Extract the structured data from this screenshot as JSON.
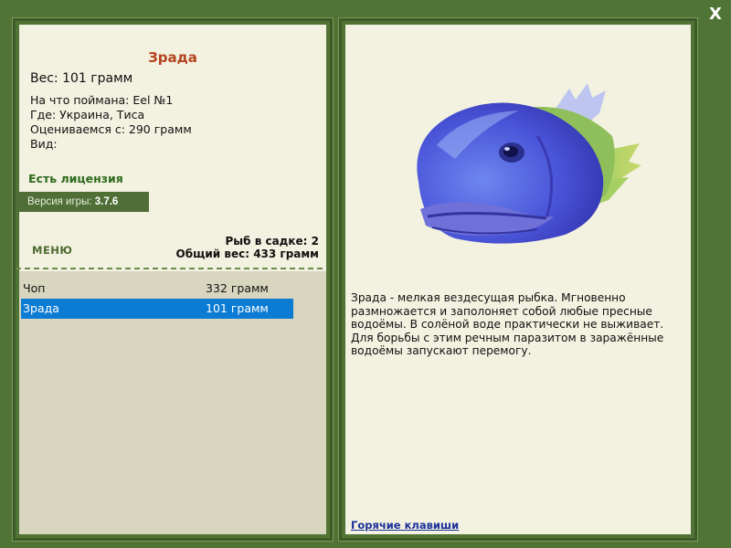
{
  "close_label": "X",
  "fish": {
    "name": "Зрада",
    "weight_line": "Вес: 101 грамм",
    "caught_on": "На что поймана: Eel №1",
    "location": "Где: Украина, Тиса",
    "valued_from": "Оцениваемся с: 290 грамм",
    "species": "Вид:",
    "description": "Зрада - мелкая вездесущая рыбка. Мгновенно размножается и заполоняет собой любые пресные водоёмы. В солёной воде практически не выживает. Для борьбы с этим речным паразитом в заражённые водоёмы запускают перемогу."
  },
  "license": "Есть лицензия",
  "version": {
    "label": "Версия игры: ",
    "value": "3.7.6"
  },
  "menu_label": "МЕНЮ",
  "keepnet": {
    "count_line": "Рыб в садке: 2",
    "total_line": "Общий вес: 433 грамм",
    "items": [
      {
        "name": "Чоп",
        "weight": "332 грамм",
        "selected": false
      },
      {
        "name": "Зрада",
        "weight": "101 грамм",
        "selected": true
      }
    ]
  },
  "hotkeys_link": "Горячие клавиши",
  "colors": {
    "background": "#507436",
    "panel": "#f3f1e0",
    "list_panel": "#d8d6bf",
    "title": "#b3441e",
    "license": "#2e6b1e",
    "selection": "#0b7bd4",
    "link": "#1a2f9a"
  },
  "icons": {
    "close": "close-icon",
    "fish_picture": "fish-image"
  }
}
